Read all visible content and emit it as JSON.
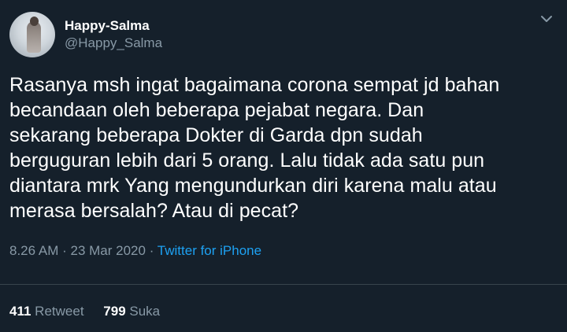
{
  "tweet": {
    "display_name": "Happy-Salma",
    "handle": "@Happy_Salma",
    "text": "Rasanya msh ingat bagaimana corona sempat jd bahan\nbecandaan oleh beberapa pejabat negara. Dan\nsekarang beberapa Dokter di Garda dpn sudah\nberguguran lebih dari 5 orang. Lalu tidak ada satu pun\ndiantara mrk Yang mengundurkan diri karena malu atau\nmerasa bersalah? Atau di pecat?",
    "time": "8.26 AM",
    "separator": "·",
    "date": "23 Mar 2020",
    "source": "Twitter for iPhone"
  },
  "stats": {
    "retweets_count": "411",
    "retweets_label": "Retweet",
    "likes_count": "799",
    "likes_label": "Suka"
  },
  "icons": {
    "menu": "chevron-down-icon"
  },
  "colors": {
    "background": "#15202b",
    "text": "#ffffff",
    "secondary_text": "#8899a6",
    "link": "#1da1f2",
    "divider": "#38444d"
  }
}
